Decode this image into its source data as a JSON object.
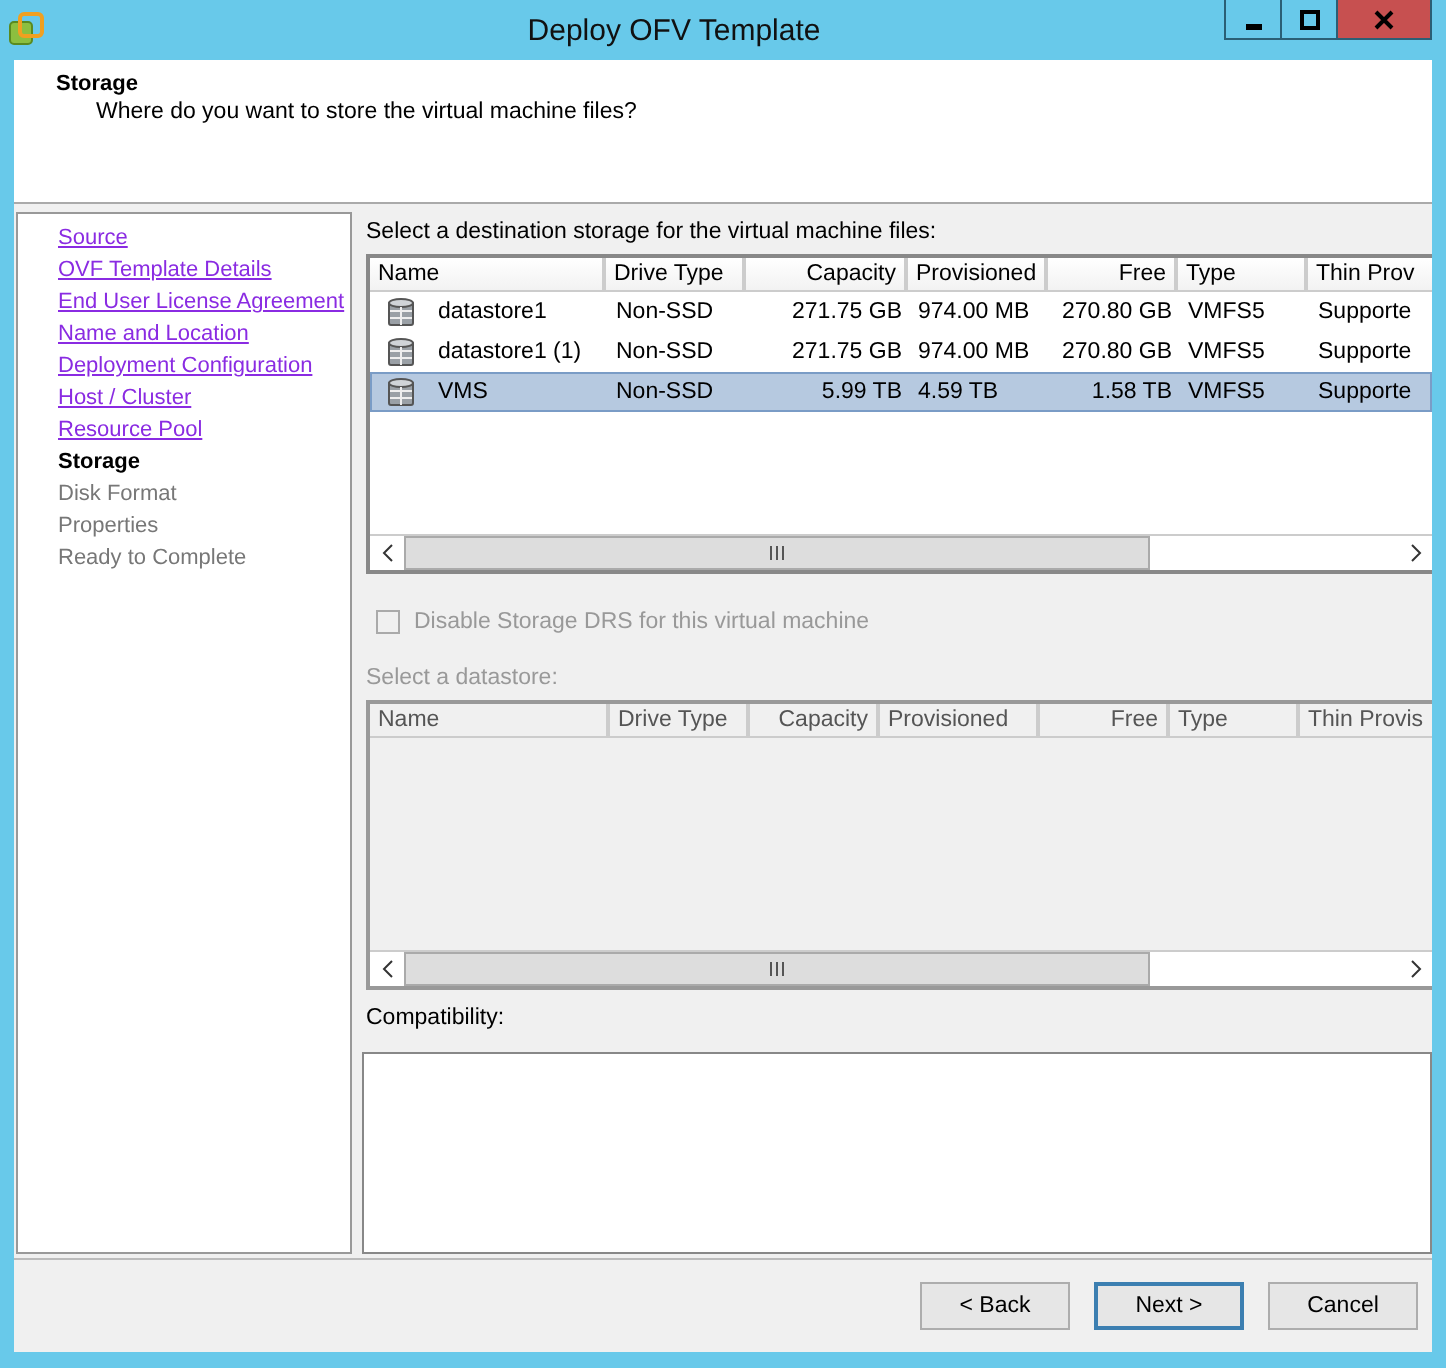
{
  "window": {
    "title": "Deploy OFV Template"
  },
  "header": {
    "title": "Storage",
    "subtitle": "Where do you want to store the virtual machine files?"
  },
  "steps": [
    {
      "label": "Source",
      "kind": "link"
    },
    {
      "label": "OVF Template Details",
      "kind": "link"
    },
    {
      "label": "End User License Agreement",
      "kind": "link"
    },
    {
      "label": "Name and Location",
      "kind": "link"
    },
    {
      "label": "Deployment Configuration",
      "kind": "link"
    },
    {
      "label": "Host / Cluster",
      "kind": "link"
    },
    {
      "label": "Resource Pool",
      "kind": "link"
    },
    {
      "label": "Storage",
      "kind": "current"
    },
    {
      "label": "Disk Format",
      "kind": "pending"
    },
    {
      "label": "Properties",
      "kind": "pending"
    },
    {
      "label": "Ready to Complete",
      "kind": "pending"
    }
  ],
  "storage_table": {
    "label": "Select a destination storage for the virtual machine files:",
    "columns": [
      "Name",
      "Drive Type",
      "Capacity",
      "Provisioned",
      "Free",
      "Type",
      "Thin Prov"
    ],
    "rows": [
      {
        "cells": [
          "datastore1",
          "Non-SSD",
          "271.75 GB",
          "974.00 MB",
          "270.80 GB",
          "VMFS5",
          "Supporte"
        ],
        "selected": false
      },
      {
        "cells": [
          "datastore1 (1)",
          "Non-SSD",
          "271.75 GB",
          "974.00 MB",
          "270.80 GB",
          "VMFS5",
          "Supporte"
        ],
        "selected": false
      },
      {
        "cells": [
          "VMS",
          "Non-SSD",
          "5.99 TB",
          "4.59 TB",
          "1.58 TB",
          "VMFS5",
          "Supporte"
        ],
        "selected": true
      }
    ]
  },
  "drs_checkbox": {
    "label": "Disable Storage DRS for this virtual machine",
    "checked": false,
    "disabled": true
  },
  "datastore_table": {
    "label": "Select a datastore:",
    "disabled": true,
    "columns": [
      "Name",
      "Drive Type",
      "Capacity",
      "Provisioned",
      "Free",
      "Type",
      "Thin Provis"
    ]
  },
  "compatibility": {
    "label": "Compatibility:"
  },
  "buttons": [
    "< Back",
    "Next >",
    "Cancel"
  ]
}
